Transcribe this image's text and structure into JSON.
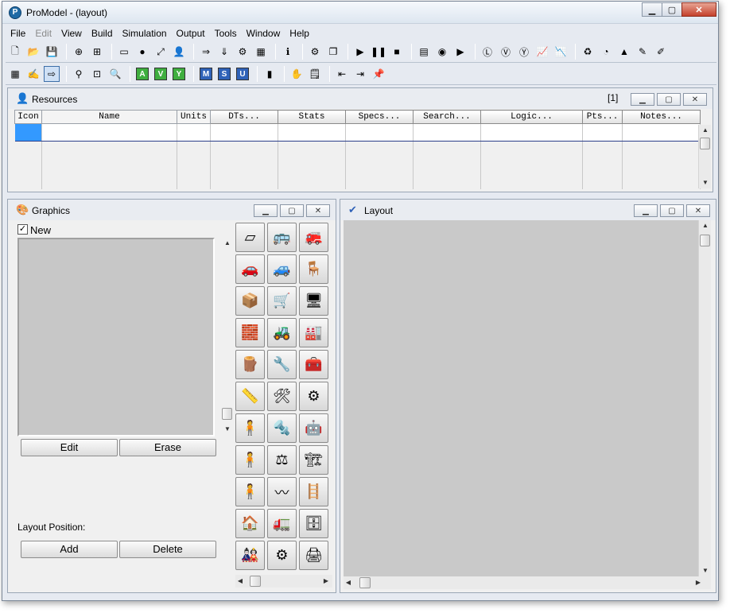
{
  "window": {
    "title": "ProModel -  (layout)",
    "app_icon_letter": "P",
    "minimize": "▁",
    "maximize": "▢",
    "close": "✕"
  },
  "menu": [
    {
      "label": "File",
      "enabled": true
    },
    {
      "label": "Edit",
      "enabled": false
    },
    {
      "label": "View",
      "enabled": true
    },
    {
      "label": "Build",
      "enabled": true
    },
    {
      "label": "Simulation",
      "enabled": true
    },
    {
      "label": "Output",
      "enabled": true
    },
    {
      "label": "Tools",
      "enabled": true
    },
    {
      "label": "Window",
      "enabled": true
    },
    {
      "label": "Help",
      "enabled": true
    }
  ],
  "toolbar1": [
    {
      "name": "new-file-icon",
      "glyph": "🗋"
    },
    {
      "name": "open-folder-icon",
      "glyph": "📂"
    },
    {
      "name": "save-icon",
      "glyph": "💾"
    },
    {
      "sep": true
    },
    {
      "name": "merge-model-icon",
      "glyph": "⊕"
    },
    {
      "name": "model-package-icon",
      "glyph": "⊞"
    },
    {
      "sep": true
    },
    {
      "name": "locations-icon",
      "glyph": "▭"
    },
    {
      "name": "entities-icon",
      "glyph": "●"
    },
    {
      "name": "path-networks-icon",
      "glyph": "⤢"
    },
    {
      "name": "resources-icon",
      "glyph": "👤"
    },
    {
      "sep": true
    },
    {
      "name": "processing-icon",
      "glyph": "⇒"
    },
    {
      "name": "arrivals-icon",
      "glyph": "⇓"
    },
    {
      "name": "shifts-icon",
      "glyph": "⚙"
    },
    {
      "name": "calendar-icon",
      "glyph": "▦"
    },
    {
      "sep": true
    },
    {
      "name": "info-icon",
      "glyph": "ℹ"
    },
    {
      "sep": true
    },
    {
      "name": "sim-options-icon",
      "glyph": "⚙"
    },
    {
      "name": "scenarios-icon",
      "glyph": "❐"
    },
    {
      "sep": true
    },
    {
      "name": "run-icon",
      "glyph": "▶"
    },
    {
      "name": "pause-icon",
      "glyph": "❚❚"
    },
    {
      "name": "stop-icon",
      "glyph": "■"
    },
    {
      "sep": true
    },
    {
      "name": "view-trace-icon",
      "glyph": "▤"
    },
    {
      "name": "simrunner-icon",
      "glyph": "◉"
    },
    {
      "name": "output-viewer-icon",
      "glyph": "▶"
    },
    {
      "sep": true
    },
    {
      "name": "lock-icon",
      "glyph": "Ⓛ"
    },
    {
      "name": "v-view-icon",
      "glyph": "Ⓥ"
    },
    {
      "name": "y-view-icon",
      "glyph": "Ⓨ"
    },
    {
      "name": "chart-icon",
      "glyph": "📈"
    },
    {
      "name": "chart-alt-icon",
      "glyph": "📉"
    },
    {
      "sep": true
    },
    {
      "name": "process-navigator-icon",
      "glyph": "♻"
    },
    {
      "name": "stat-fit-icon",
      "glyph": "◔"
    },
    {
      "name": "triangle-icon",
      "glyph": "▲"
    },
    {
      "name": "tools-icon",
      "glyph": "✎"
    },
    {
      "name": "graphic-editor-icon",
      "glyph": "✐"
    }
  ],
  "toolbar2": [
    {
      "name": "grid-icon",
      "glyph": "▦"
    },
    {
      "name": "edit-table-icon",
      "glyph": "✍"
    },
    {
      "name": "goto-icon",
      "glyph": "⇨",
      "active": true
    },
    {
      "sep": true
    },
    {
      "name": "zoom-icon",
      "glyph": "⚲"
    },
    {
      "name": "zoom-window-icon",
      "glyph": "⊡"
    },
    {
      "name": "find-icon",
      "glyph": "🔍"
    },
    {
      "sep": true
    },
    {
      "letter": "A",
      "color": "green",
      "name": "a-button"
    },
    {
      "letter": "V",
      "color": "green",
      "name": "v-button"
    },
    {
      "letter": "Y",
      "color": "green",
      "name": "y-button"
    },
    {
      "sep": true
    },
    {
      "letter": "M",
      "color": "blue",
      "name": "m-button"
    },
    {
      "letter": "S",
      "color": "blue",
      "name": "s-button"
    },
    {
      "letter": "U",
      "color": "blue",
      "name": "u-button"
    },
    {
      "sep": true
    },
    {
      "name": "bookmark-icon",
      "glyph": "▮"
    },
    {
      "sep": true
    },
    {
      "name": "hand-icon",
      "glyph": "✋"
    },
    {
      "name": "notes-icon",
      "glyph": "🗒"
    },
    {
      "sep": true
    },
    {
      "name": "import-icon",
      "glyph": "⇤"
    },
    {
      "name": "export-icon",
      "glyph": "⇥"
    },
    {
      "name": "pin-icon",
      "glyph": "📌"
    }
  ],
  "resources": {
    "title": "Resources",
    "record_index": "[1]",
    "columns": [
      {
        "label": "Icon",
        "button": false
      },
      {
        "label": "Name",
        "button": false
      },
      {
        "label": "Units",
        "button": false
      },
      {
        "label": "DTs...",
        "button": true
      },
      {
        "label": "Stats",
        "button": true
      },
      {
        "label": "Specs...",
        "button": true
      },
      {
        "label": "Search...",
        "button": true
      },
      {
        "label": "Logic...",
        "button": true
      },
      {
        "label": "Pts...",
        "button": true
      },
      {
        "label": "Notes...",
        "button": true
      }
    ]
  },
  "graphics": {
    "title": "Graphics",
    "new_label": "New",
    "new_checked": "✓",
    "edit_label": "Edit",
    "erase_label": "Erase",
    "layout_position_label": "Layout Position:",
    "add_label": "Add",
    "delete_label": "Delete",
    "library": [
      "▱",
      "🚌",
      "🚒",
      "🚗",
      "🚙",
      "🪑",
      "📦",
      "🛒",
      "🖥",
      "🧱",
      "🚜",
      "🏭",
      "🪵",
      "🔧",
      "🧰",
      "📏",
      "🛠",
      "⚙",
      "🧍",
      "🔩",
      "🤖",
      "🧍",
      "⚖",
      "🏗",
      "🧍",
      "〰",
      "🪜",
      "🏠",
      "🚛",
      "🗄",
      "🎎",
      "⚙",
      "🖨"
    ]
  },
  "layout": {
    "title": "Layout"
  },
  "colors": {
    "selected_cell": "#3399ff",
    "canvas": "#c9c9c9"
  }
}
